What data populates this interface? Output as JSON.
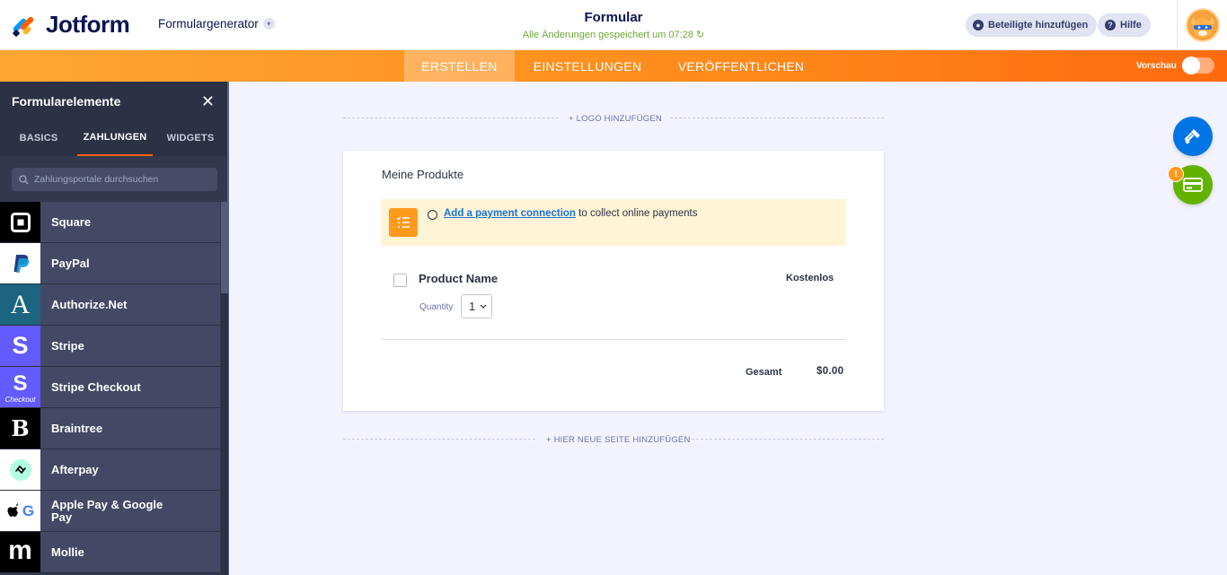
{
  "header": {
    "brand": "Jotform",
    "form_builder": "Formulargenerator",
    "form_title": "Formular",
    "save_status": "Alle Änderungen gespeichert um 07:28 ↻",
    "add_collaborators": "Beteiligte hinzufügen",
    "help": "Hilfe"
  },
  "nav": {
    "tabs": [
      "ERSTELLEN",
      "EINSTELLUNGEN",
      "VERÖFFENTLICHEN"
    ],
    "preview": "Vorschau"
  },
  "sidebar": {
    "title": "Formularelemente",
    "tabs": [
      "BASICS",
      "ZAHLUNGEN",
      "WIDGETS"
    ],
    "search_placeholder": "Zahlungsportale durchsuchen",
    "items": [
      {
        "label": "Square"
      },
      {
        "label": "PayPal"
      },
      {
        "label": "Authorize.Net"
      },
      {
        "label": "Stripe"
      },
      {
        "label": "Stripe Checkout",
        "icon_caption": "Checkout"
      },
      {
        "label": "Braintree"
      },
      {
        "label": "Afterpay"
      },
      {
        "label": "Apple Pay & Google Pay"
      },
      {
        "label": "Mollie"
      }
    ]
  },
  "canvas": {
    "add_logo": "+ LOGO HINZUFÜGEN",
    "add_page": "+ HIER NEUE SEITE HINZUFÜGEN",
    "card": {
      "title": "Meine Produkte",
      "notice_link": "Add a payment connection",
      "notice_rest": " to collect online payments",
      "product_name": "Product Name",
      "product_price": "Kostenlos",
      "quantity_label": "Quantity",
      "quantity_value": "1",
      "total_label": "Gesamt",
      "total_value": "$0.00"
    },
    "fab_badge": "!"
  }
}
